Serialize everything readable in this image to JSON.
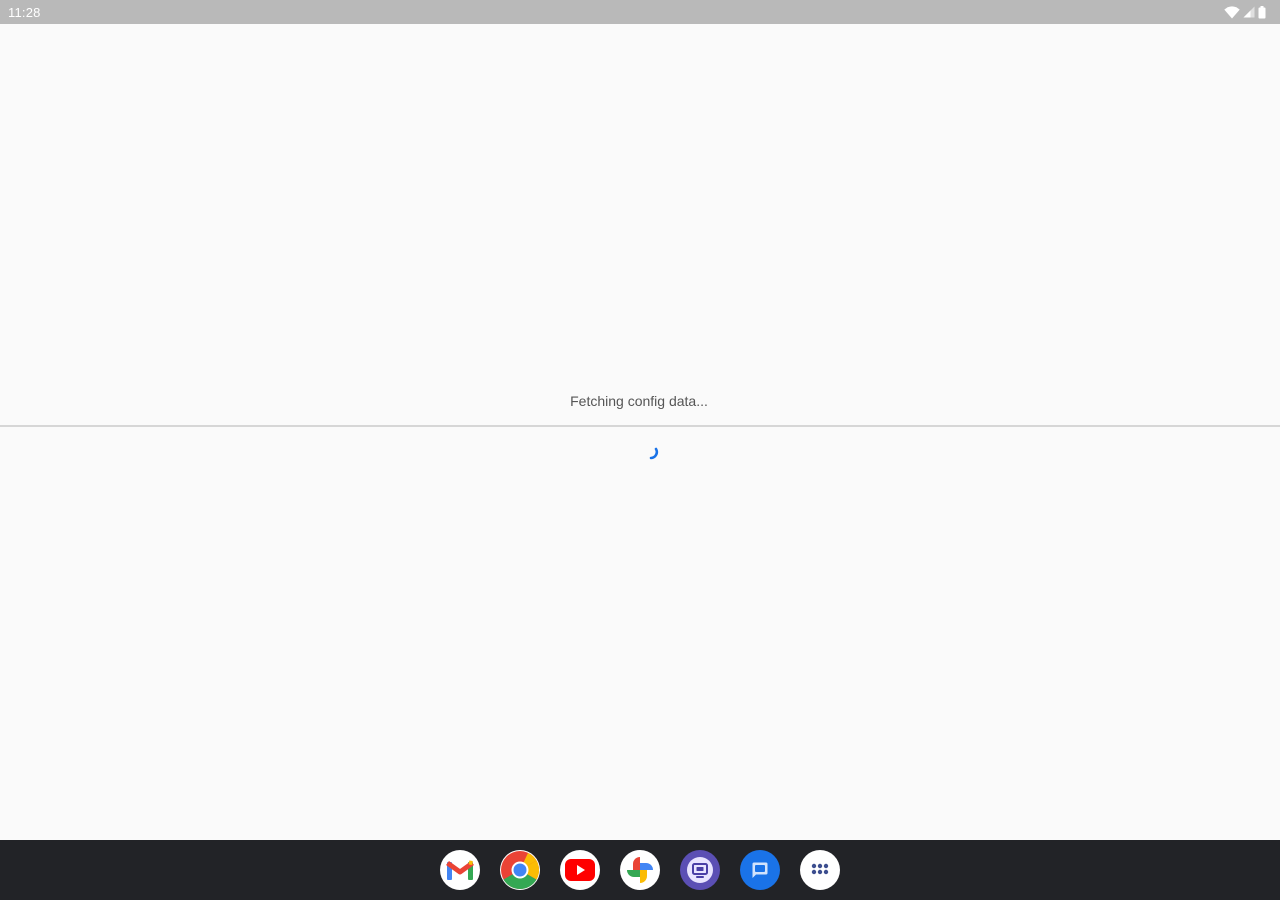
{
  "status_bar": {
    "time": "11:28",
    "icons": [
      "wifi-icon",
      "signal-icon",
      "battery-icon"
    ]
  },
  "main": {
    "loading_text": "Fetching config data...",
    "spinner": "loading-spinner-icon"
  },
  "taskbar": {
    "apps": [
      {
        "name": "gmail-icon"
      },
      {
        "name": "chrome-icon"
      },
      {
        "name": "youtube-icon"
      },
      {
        "name": "photos-icon"
      },
      {
        "name": "screen-recorder-icon"
      },
      {
        "name": "messages-icon"
      },
      {
        "name": "app-drawer-icon"
      }
    ]
  },
  "colors": {
    "status_bar_bg": "#b9b9b9",
    "background": "#fafafa",
    "taskbar_bg": "#222327",
    "accent_blue": "#1a73e8",
    "youtube_red": "#ff0000",
    "gmail_red": "#ea4335"
  }
}
